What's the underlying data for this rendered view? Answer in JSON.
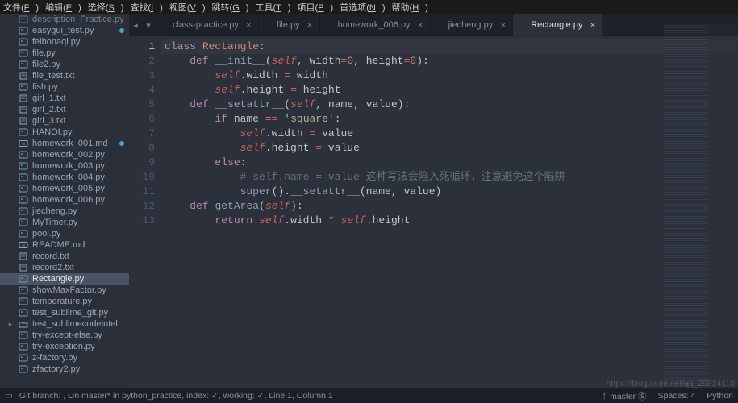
{
  "menubar": [
    {
      "label": "文件",
      "accel": "F"
    },
    {
      "label": "编辑",
      "accel": "E"
    },
    {
      "label": "选择",
      "accel": "S"
    },
    {
      "label": "查找",
      "accel": "I"
    },
    {
      "label": "视图",
      "accel": "V"
    },
    {
      "label": "跳转",
      "accel": "G"
    },
    {
      "label": "工具",
      "accel": "T"
    },
    {
      "label": "项目",
      "accel": "P"
    },
    {
      "label": "首选项",
      "accel": "N"
    },
    {
      "label": "帮助",
      "accel": "H"
    }
  ],
  "sidebar": {
    "items": [
      {
        "name": "description_Practice.py",
        "type": "py",
        "dim": true
      },
      {
        "name": "easygui_test.py",
        "type": "py",
        "modified": true
      },
      {
        "name": "feibonaqi.py",
        "type": "py"
      },
      {
        "name": "file.py",
        "type": "py"
      },
      {
        "name": "file2.py",
        "type": "py"
      },
      {
        "name": "file_test.txt",
        "type": "txt"
      },
      {
        "name": "fish.py",
        "type": "py"
      },
      {
        "name": "girl_1.txt",
        "type": "txt"
      },
      {
        "name": "girl_2.txt",
        "type": "txt"
      },
      {
        "name": "girl_3.txt",
        "type": "txt"
      },
      {
        "name": "HANOI.py",
        "type": "py"
      },
      {
        "name": "homework_001.md",
        "type": "md",
        "modified": true
      },
      {
        "name": "homework_002.py",
        "type": "py"
      },
      {
        "name": "homework_003.py",
        "type": "py"
      },
      {
        "name": "homework_004.py",
        "type": "py"
      },
      {
        "name": "homework_005.py",
        "type": "py"
      },
      {
        "name": "homework_006.py",
        "type": "py"
      },
      {
        "name": "jiecheng.py",
        "type": "py"
      },
      {
        "name": "MyTimer.py",
        "type": "py"
      },
      {
        "name": "pool.py",
        "type": "py"
      },
      {
        "name": "README.md",
        "type": "md"
      },
      {
        "name": "record.txt",
        "type": "txt"
      },
      {
        "name": "record2.txt",
        "type": "txt"
      },
      {
        "name": "Rectangle.py",
        "type": "py",
        "selected": true
      },
      {
        "name": "showMaxFactor.py",
        "type": "py"
      },
      {
        "name": "temperature.py",
        "type": "py"
      },
      {
        "name": "test_sublime_git.py",
        "type": "py"
      },
      {
        "name": "test_sublimecodeintel",
        "type": "folder"
      },
      {
        "name": "try-except-else.py",
        "type": "py"
      },
      {
        "name": "try-exception.py",
        "type": "py"
      },
      {
        "name": "z-factory.py",
        "type": "py"
      },
      {
        "name": "zfactory2.py",
        "type": "py"
      }
    ]
  },
  "tabs": {
    "arrows": {
      "left": "◂",
      "right": "▾"
    },
    "items": [
      {
        "label": "class-practice.py",
        "active": false
      },
      {
        "label": "file.py",
        "active": false
      },
      {
        "label": "homework_006.py",
        "active": false
      },
      {
        "label": "jiecheng.py",
        "active": false
      },
      {
        "label": "Rectangle.py",
        "active": true
      }
    ],
    "close_glyph": "×"
  },
  "editor": {
    "highlight_line": 1,
    "lines": [
      [
        [
          "kw",
          "class"
        ],
        [
          "punc",
          " "
        ],
        [
          "cls",
          "Rectangle"
        ],
        [
          "punc",
          ":"
        ]
      ],
      [
        [
          "punc",
          "    "
        ],
        [
          "kw",
          "def"
        ],
        [
          "punc",
          " "
        ],
        [
          "fn",
          "__init__"
        ],
        [
          "punc",
          "("
        ],
        [
          "self",
          "self"
        ],
        [
          "punc",
          ", "
        ],
        [
          "var",
          "width"
        ],
        [
          "op",
          "="
        ],
        [
          "num",
          "0"
        ],
        [
          "punc",
          ", "
        ],
        [
          "var",
          "height"
        ],
        [
          "op",
          "="
        ],
        [
          "num",
          "0"
        ],
        [
          "punc",
          ")"
        ],
        [
          "punc",
          ":"
        ]
      ],
      [
        [
          "punc",
          "        "
        ],
        [
          "self",
          "self"
        ],
        [
          "punc",
          "."
        ],
        [
          "var",
          "width"
        ],
        [
          "punc",
          " "
        ],
        [
          "op",
          "="
        ],
        [
          "punc",
          " "
        ],
        [
          "var",
          "width"
        ]
      ],
      [
        [
          "punc",
          "        "
        ],
        [
          "self",
          "self"
        ],
        [
          "punc",
          "."
        ],
        [
          "var",
          "height"
        ],
        [
          "punc",
          " "
        ],
        [
          "op",
          "="
        ],
        [
          "punc",
          " "
        ],
        [
          "var",
          "height"
        ]
      ],
      [
        [
          "punc",
          "    "
        ],
        [
          "kw",
          "def"
        ],
        [
          "punc",
          " "
        ],
        [
          "fn",
          "__setattr__"
        ],
        [
          "punc",
          "("
        ],
        [
          "self",
          "self"
        ],
        [
          "punc",
          ", "
        ],
        [
          "var",
          "name"
        ],
        [
          "punc",
          ", "
        ],
        [
          "var",
          "value"
        ],
        [
          "punc",
          ")"
        ],
        [
          "punc",
          ":"
        ]
      ],
      [
        [
          "punc",
          "        "
        ],
        [
          "kw",
          "if"
        ],
        [
          "punc",
          " "
        ],
        [
          "var",
          "name"
        ],
        [
          "punc",
          " "
        ],
        [
          "op",
          "=="
        ],
        [
          "punc",
          " "
        ],
        [
          "str",
          "'square'"
        ],
        [
          "punc",
          ":"
        ]
      ],
      [
        [
          "punc",
          "            "
        ],
        [
          "self",
          "self"
        ],
        [
          "punc",
          "."
        ],
        [
          "var",
          "width"
        ],
        [
          "punc",
          " "
        ],
        [
          "op",
          "="
        ],
        [
          "punc",
          " "
        ],
        [
          "var",
          "value"
        ]
      ],
      [
        [
          "punc",
          "            "
        ],
        [
          "self",
          "self"
        ],
        [
          "punc",
          "."
        ],
        [
          "var",
          "height"
        ],
        [
          "punc",
          " "
        ],
        [
          "op",
          "="
        ],
        [
          "punc",
          " "
        ],
        [
          "var",
          "value"
        ]
      ],
      [
        [
          "punc",
          "        "
        ],
        [
          "kw",
          "else"
        ],
        [
          "punc",
          ":"
        ]
      ],
      [
        [
          "punc",
          "            "
        ],
        [
          "cm",
          "# self.name = value 这种写法会陷入死循环，注意避免这个陷阱"
        ]
      ],
      [
        [
          "punc",
          "            "
        ],
        [
          "builtin",
          "super"
        ],
        [
          "punc",
          "()"
        ],
        [
          "punc",
          "."
        ],
        [
          "fn",
          "__setattr__"
        ],
        [
          "punc",
          "("
        ],
        [
          "var",
          "name"
        ],
        [
          "punc",
          ", "
        ],
        [
          "var",
          "value"
        ],
        [
          "punc",
          ")"
        ]
      ],
      [
        [
          "punc",
          "    "
        ],
        [
          "kw",
          "def"
        ],
        [
          "punc",
          " "
        ],
        [
          "fn",
          "getArea"
        ],
        [
          "punc",
          "("
        ],
        [
          "self",
          "self"
        ],
        [
          "punc",
          ")"
        ],
        [
          "punc",
          ":"
        ]
      ],
      [
        [
          "punc",
          "        "
        ],
        [
          "kw",
          "return"
        ],
        [
          "punc",
          " "
        ],
        [
          "self",
          "self"
        ],
        [
          "punc",
          "."
        ],
        [
          "var",
          "width"
        ],
        [
          "punc",
          " "
        ],
        [
          "op",
          "*"
        ],
        [
          "punc",
          " "
        ],
        [
          "self",
          "self"
        ],
        [
          "punc",
          "."
        ],
        [
          "var",
          "height"
        ]
      ]
    ]
  },
  "statusbar": {
    "console_icon": "▭",
    "left": "Git branch: , On master* in python_practice, index: ✓, working: ✓, Line 1, Column 1",
    "branch_icon": "ᚶ",
    "branch": "master",
    "s_icon": "Ⓢ",
    "spaces": "Spaces: 4",
    "lang": "Python"
  },
  "watermark": "https://blog.csdn.net/qq_29824110"
}
